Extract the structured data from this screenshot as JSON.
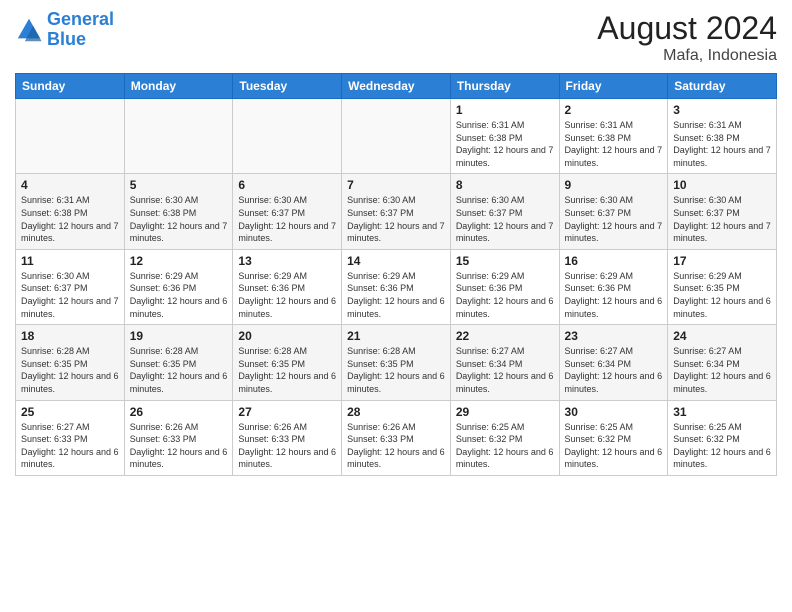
{
  "logo": {
    "line1": "General",
    "line2": "Blue"
  },
  "title": "August 2024",
  "subtitle": "Mafa, Indonesia",
  "days_header": [
    "Sunday",
    "Monday",
    "Tuesday",
    "Wednesday",
    "Thursday",
    "Friday",
    "Saturday"
  ],
  "weeks": [
    [
      {
        "day": "",
        "info": ""
      },
      {
        "day": "",
        "info": ""
      },
      {
        "day": "",
        "info": ""
      },
      {
        "day": "",
        "info": ""
      },
      {
        "day": "1",
        "info": "Sunrise: 6:31 AM\nSunset: 6:38 PM\nDaylight: 12 hours and 7 minutes."
      },
      {
        "day": "2",
        "info": "Sunrise: 6:31 AM\nSunset: 6:38 PM\nDaylight: 12 hours and 7 minutes."
      },
      {
        "day": "3",
        "info": "Sunrise: 6:31 AM\nSunset: 6:38 PM\nDaylight: 12 hours and 7 minutes."
      }
    ],
    [
      {
        "day": "4",
        "info": "Sunrise: 6:31 AM\nSunset: 6:38 PM\nDaylight: 12 hours and 7 minutes."
      },
      {
        "day": "5",
        "info": "Sunrise: 6:30 AM\nSunset: 6:38 PM\nDaylight: 12 hours and 7 minutes."
      },
      {
        "day": "6",
        "info": "Sunrise: 6:30 AM\nSunset: 6:37 PM\nDaylight: 12 hours and 7 minutes."
      },
      {
        "day": "7",
        "info": "Sunrise: 6:30 AM\nSunset: 6:37 PM\nDaylight: 12 hours and 7 minutes."
      },
      {
        "day": "8",
        "info": "Sunrise: 6:30 AM\nSunset: 6:37 PM\nDaylight: 12 hours and 7 minutes."
      },
      {
        "day": "9",
        "info": "Sunrise: 6:30 AM\nSunset: 6:37 PM\nDaylight: 12 hours and 7 minutes."
      },
      {
        "day": "10",
        "info": "Sunrise: 6:30 AM\nSunset: 6:37 PM\nDaylight: 12 hours and 7 minutes."
      }
    ],
    [
      {
        "day": "11",
        "info": "Sunrise: 6:30 AM\nSunset: 6:37 PM\nDaylight: 12 hours and 7 minutes."
      },
      {
        "day": "12",
        "info": "Sunrise: 6:29 AM\nSunset: 6:36 PM\nDaylight: 12 hours and 6 minutes."
      },
      {
        "day": "13",
        "info": "Sunrise: 6:29 AM\nSunset: 6:36 PM\nDaylight: 12 hours and 6 minutes."
      },
      {
        "day": "14",
        "info": "Sunrise: 6:29 AM\nSunset: 6:36 PM\nDaylight: 12 hours and 6 minutes."
      },
      {
        "day": "15",
        "info": "Sunrise: 6:29 AM\nSunset: 6:36 PM\nDaylight: 12 hours and 6 minutes."
      },
      {
        "day": "16",
        "info": "Sunrise: 6:29 AM\nSunset: 6:36 PM\nDaylight: 12 hours and 6 minutes."
      },
      {
        "day": "17",
        "info": "Sunrise: 6:29 AM\nSunset: 6:35 PM\nDaylight: 12 hours and 6 minutes."
      }
    ],
    [
      {
        "day": "18",
        "info": "Sunrise: 6:28 AM\nSunset: 6:35 PM\nDaylight: 12 hours and 6 minutes."
      },
      {
        "day": "19",
        "info": "Sunrise: 6:28 AM\nSunset: 6:35 PM\nDaylight: 12 hours and 6 minutes."
      },
      {
        "day": "20",
        "info": "Sunrise: 6:28 AM\nSunset: 6:35 PM\nDaylight: 12 hours and 6 minutes."
      },
      {
        "day": "21",
        "info": "Sunrise: 6:28 AM\nSunset: 6:35 PM\nDaylight: 12 hours and 6 minutes."
      },
      {
        "day": "22",
        "info": "Sunrise: 6:27 AM\nSunset: 6:34 PM\nDaylight: 12 hours and 6 minutes."
      },
      {
        "day": "23",
        "info": "Sunrise: 6:27 AM\nSunset: 6:34 PM\nDaylight: 12 hours and 6 minutes."
      },
      {
        "day": "24",
        "info": "Sunrise: 6:27 AM\nSunset: 6:34 PM\nDaylight: 12 hours and 6 minutes."
      }
    ],
    [
      {
        "day": "25",
        "info": "Sunrise: 6:27 AM\nSunset: 6:33 PM\nDaylight: 12 hours and 6 minutes."
      },
      {
        "day": "26",
        "info": "Sunrise: 6:26 AM\nSunset: 6:33 PM\nDaylight: 12 hours and 6 minutes."
      },
      {
        "day": "27",
        "info": "Sunrise: 6:26 AM\nSunset: 6:33 PM\nDaylight: 12 hours and 6 minutes."
      },
      {
        "day": "28",
        "info": "Sunrise: 6:26 AM\nSunset: 6:33 PM\nDaylight: 12 hours and 6 minutes."
      },
      {
        "day": "29",
        "info": "Sunrise: 6:25 AM\nSunset: 6:32 PM\nDaylight: 12 hours and 6 minutes."
      },
      {
        "day": "30",
        "info": "Sunrise: 6:25 AM\nSunset: 6:32 PM\nDaylight: 12 hours and 6 minutes."
      },
      {
        "day": "31",
        "info": "Sunrise: 6:25 AM\nSunset: 6:32 PM\nDaylight: 12 hours and 6 minutes."
      }
    ]
  ]
}
